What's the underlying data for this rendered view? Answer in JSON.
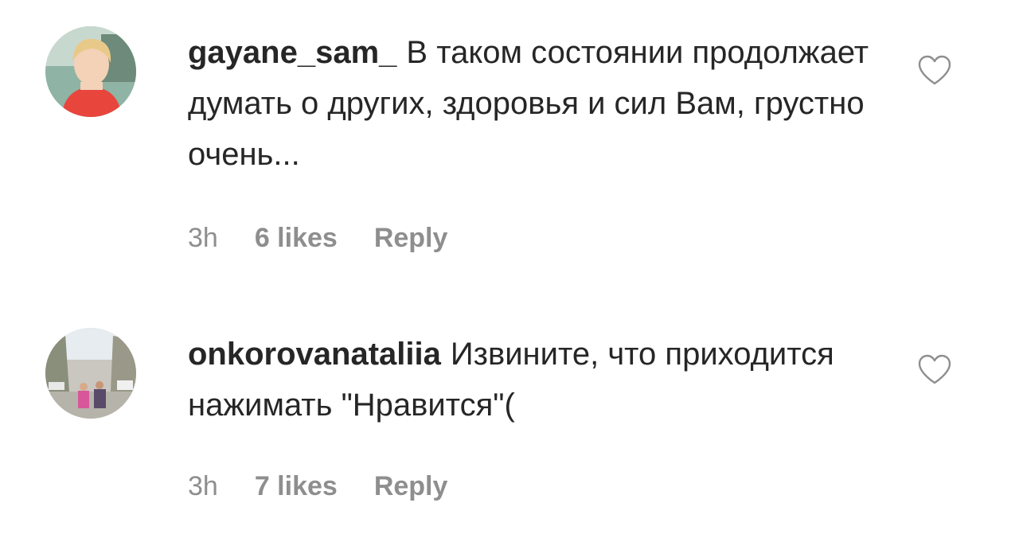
{
  "comments": [
    {
      "username": "gayane_sam_",
      "text": "В таком состоянии продолжает думать о других, здоровья и сил Вам, грустно очень...",
      "time": "3h",
      "likes": "6 likes",
      "reply_label": "Reply",
      "avatar_icon": "avatar-photo-woman-red-dress",
      "heart_icon": "heart-outline-icon"
    },
    {
      "username": "onkorovanataliia",
      "text": "Извините, что приходится нажимать \"Нравится\"(",
      "time": "3h",
      "likes": "7 likes",
      "reply_label": "Reply",
      "avatar_icon": "avatar-photo-couple-street",
      "heart_icon": "heart-outline-icon"
    }
  ],
  "colors": {
    "text_primary": "#262626",
    "text_secondary": "#8e8e8e",
    "heart_stroke": "#8e8e8e",
    "background": "#ffffff"
  }
}
